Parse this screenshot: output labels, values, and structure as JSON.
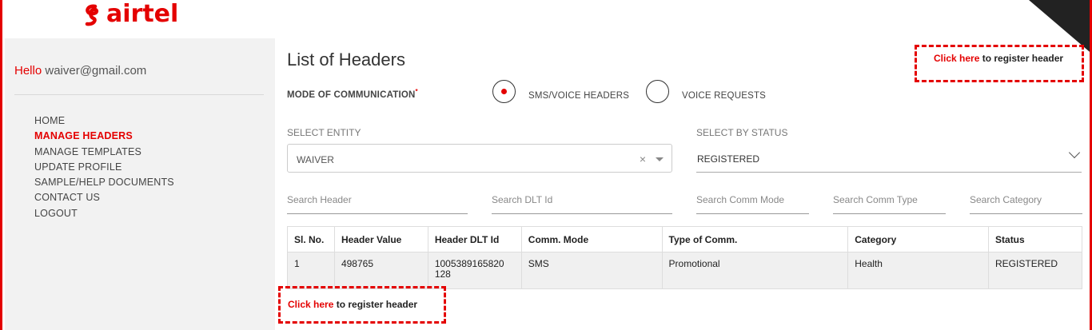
{
  "brand": {
    "name": "airtel",
    "color": "#e40000"
  },
  "sidebar": {
    "hello": "Hello",
    "email": "waiver@gmail.com",
    "items": [
      {
        "label": "HOME"
      },
      {
        "label": "MANAGE HEADERS"
      },
      {
        "label": "MANAGE TEMPLATES"
      },
      {
        "label": "UPDATE PROFILE"
      },
      {
        "label": "SAMPLE/HELP DOCUMENTS"
      },
      {
        "label": "CONTACT US"
      },
      {
        "label": "LOGOUT"
      }
    ],
    "active_item": "MANAGE HEADERS"
  },
  "main": {
    "title": "List of Headers",
    "register_link": {
      "click": "Click here",
      "rest": "to register header"
    },
    "mode": {
      "label": "MODE OF COMMUNICATION",
      "required_mark": "*",
      "options": [
        {
          "label": "SMS/VOICE HEADERS",
          "selected": true
        },
        {
          "label": "VOICE REQUESTS",
          "selected": false
        }
      ]
    },
    "entity": {
      "label": "SELECT ENTITY",
      "value": "WAIVER",
      "clear": "×"
    },
    "status": {
      "label": "SELECT BY STATUS",
      "value": "REGISTERED"
    },
    "search": {
      "header": "Search Header",
      "dlt_id": "Search DLT Id",
      "comm_mode": "Search Comm Mode",
      "comm_type": "Search Comm Type",
      "category": "Search Category"
    },
    "table": {
      "columns": [
        "Sl. No.",
        "Header Value",
        "Header DLT Id",
        "Comm. Mode",
        "Type of Comm.",
        "Category",
        "Status"
      ],
      "rows": [
        {
          "sl": "1",
          "header_value": "498765",
          "dlt_id_line1": "1005389165820",
          "dlt_id_line2": "128",
          "comm_mode": "SMS",
          "comm_type": "Promotional",
          "category": "Health",
          "status": "REGISTERED"
        }
      ]
    }
  }
}
